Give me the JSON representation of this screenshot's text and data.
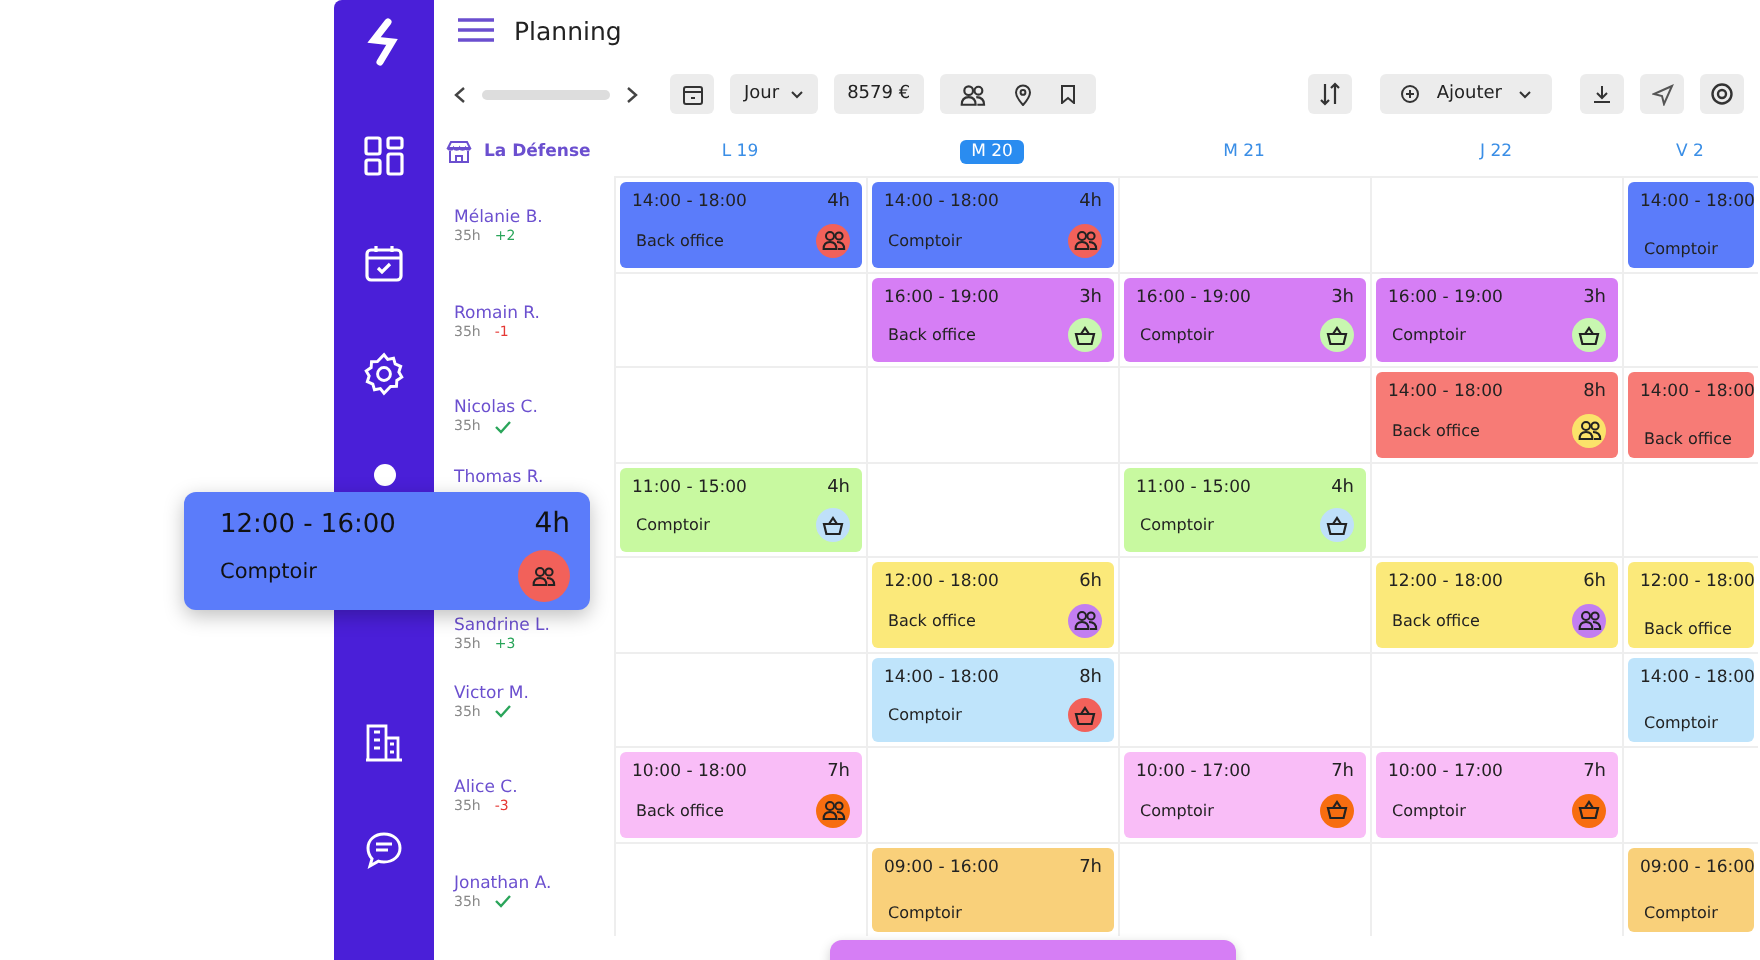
{
  "header": {
    "title": "Planning"
  },
  "toolbar": {
    "view": "Jour",
    "total": "8579 €",
    "add": "Ajouter"
  },
  "location": "La Défense",
  "days": [
    {
      "label": "L 19",
      "selected": false
    },
    {
      "label": "M 20",
      "selected": true
    },
    {
      "label": "M 21",
      "selected": false
    },
    {
      "label": "J 22",
      "selected": false
    },
    {
      "label": "V 2",
      "selected": false
    }
  ],
  "employees": [
    {
      "name": "Mélanie B.",
      "hours": "35h",
      "balance": {
        "kind": "number",
        "text": "+2",
        "color": "#2aa55a"
      },
      "cells": [
        {
          "time": "14:00 - 18:00",
          "duration": "4h",
          "label": "Back office",
          "color": "#5b7cfa",
          "badge": {
            "kind": "people",
            "color": "#f2615a"
          }
        },
        {
          "time": "14:00 - 18:00",
          "duration": "4h",
          "label": "Comptoir",
          "color": "#5b7cfa",
          "badge": {
            "kind": "people",
            "color": "#f2615a"
          }
        },
        null,
        null,
        {
          "time": "14:00 - 18:00",
          "label": "Comptoir",
          "color": "#5b7cfa"
        }
      ]
    },
    {
      "name": "Romain R.",
      "hours": "35h",
      "balance": {
        "kind": "number",
        "text": "-1",
        "color": "#e53935"
      },
      "cells": [
        null,
        {
          "time": "16:00 - 19:00",
          "duration": "3h",
          "label": "Back office",
          "color": "#d67ef5",
          "badge": {
            "kind": "basket",
            "color": "#c8f7b0"
          }
        },
        {
          "time": "16:00 - 19:00",
          "duration": "3h",
          "label": "Comptoir",
          "color": "#d67ef5",
          "badge": {
            "kind": "basket",
            "color": "#c8f7b0"
          }
        },
        {
          "time": "16:00 - 19:00",
          "duration": "3h",
          "label": "Comptoir",
          "color": "#d67ef5",
          "badge": {
            "kind": "basket",
            "color": "#c8f7b0"
          }
        },
        null
      ]
    },
    {
      "name": "Nicolas C.",
      "hours": "35h",
      "balance": {
        "kind": "check",
        "color": "#2aa55a"
      },
      "cells": [
        null,
        null,
        null,
        {
          "time": "14:00 - 18:00",
          "duration": "8h",
          "label": "Back office",
          "color": "#f77b76",
          "badge": {
            "kind": "people",
            "color": "#fbe36a"
          }
        },
        {
          "time": "14:00 - 18:00",
          "label": "Back office",
          "color": "#f77b76"
        }
      ]
    },
    {
      "name": "Thomas R.",
      "cells": [
        {
          "time": "11:00 - 15:00",
          "duration": "4h",
          "label": "Comptoir",
          "color": "#c8f9a0",
          "badge": {
            "kind": "basket",
            "color": "#bfe0f9"
          }
        },
        null,
        {
          "time": "11:00 - 15:00",
          "duration": "4h",
          "label": "Comptoir",
          "color": "#c8f9a0",
          "badge": {
            "kind": "basket",
            "color": "#bfe0f9"
          }
        },
        null,
        null
      ]
    },
    {
      "name": "Sandrine L.",
      "hours": "35h",
      "balance": {
        "kind": "number",
        "text": "+3",
        "color": "#2aa55a"
      },
      "cells": [
        null,
        {
          "time": "12:00 - 18:00",
          "duration": "6h",
          "label": "Back office",
          "color": "#fbe97a",
          "badge": {
            "kind": "people",
            "color": "#c27ef0"
          }
        },
        null,
        {
          "time": "12:00 - 18:00",
          "duration": "6h",
          "label": "Back office",
          "color": "#fbe97a",
          "badge": {
            "kind": "people",
            "color": "#c27ef0"
          }
        },
        {
          "time": "12:00 - 18:00",
          "label": "Back office",
          "color": "#fbe97a"
        }
      ]
    },
    {
      "name": "Victor M.",
      "hours": "35h",
      "balance": {
        "kind": "check",
        "color": "#2aa55a"
      },
      "cells": [
        null,
        {
          "time": "14:00 - 18:00",
          "duration": "8h",
          "label": "Comptoir",
          "color": "#bfe4fb",
          "badge": {
            "kind": "basket",
            "color": "#f2615a"
          }
        },
        null,
        null,
        {
          "time": "14:00 - 18:00",
          "label": "Comptoir",
          "color": "#bfe4fb"
        }
      ]
    },
    {
      "name": "Alice C.",
      "hours": "35h",
      "balance": {
        "kind": "number",
        "text": "-3",
        "color": "#e53935"
      },
      "cells": [
        {
          "time": "10:00 - 18:00",
          "duration": "7h",
          "label": "Back office",
          "color": "#f9bdf7",
          "badge": {
            "kind": "people",
            "color": "#f76d10"
          }
        },
        null,
        {
          "time": "10:00 - 17:00",
          "duration": "7h",
          "label": "Comptoir",
          "color": "#f9bdf7",
          "badge": {
            "kind": "basket",
            "color": "#f76d10"
          }
        },
        {
          "time": "10:00 - 17:00",
          "duration": "7h",
          "label": "Comptoir",
          "color": "#f9bdf7",
          "badge": {
            "kind": "basket",
            "color": "#f76d10"
          }
        },
        null
      ]
    },
    {
      "name": "Jonathan A.",
      "hours": "35h",
      "balance": {
        "kind": "check",
        "color": "#2aa55a"
      },
      "cells": [
        null,
        {
          "time": "09:00 - 16:00",
          "duration": "7h",
          "label": "Comptoir",
          "color": "#f9d07a"
        },
        null,
        null,
        {
          "time": "09:00 - 16:00",
          "label": "Comptoir",
          "color": "#f9d07a"
        }
      ]
    }
  ],
  "floating_shift": {
    "time": "12:00 - 16:00",
    "duration": "4h",
    "label": "Comptoir",
    "color": "#5b7cfa",
    "badge": {
      "kind": "people",
      "color": "#f2615a"
    }
  },
  "dragged_shift": {
    "color": "#d67ef5"
  }
}
